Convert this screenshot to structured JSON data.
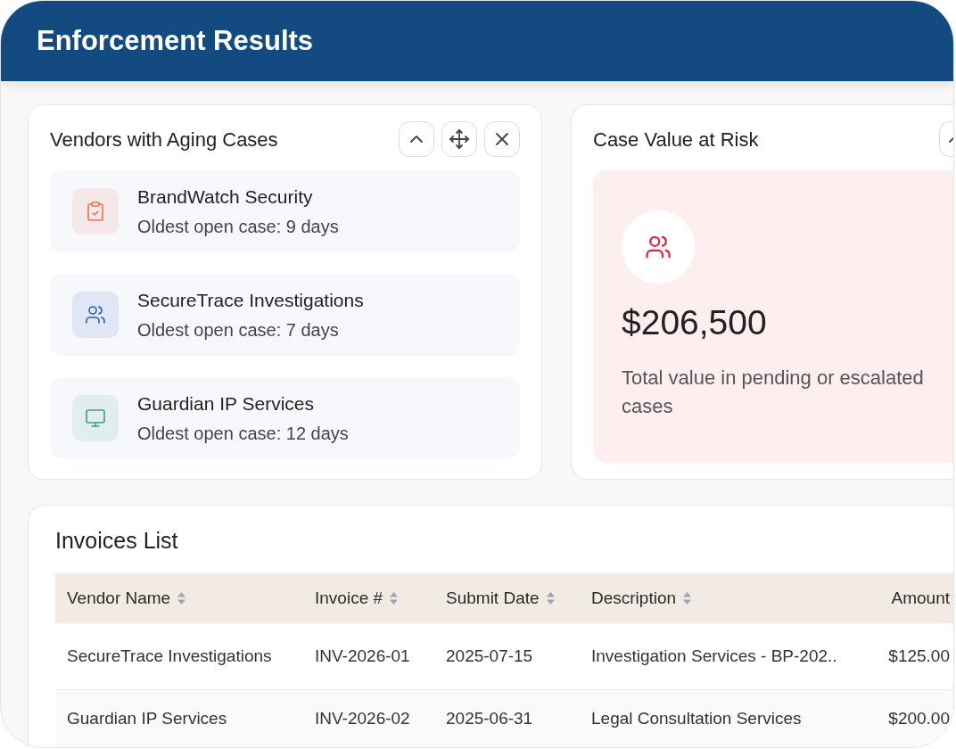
{
  "header": {
    "title": "Enforcement Results"
  },
  "aging_vendors": {
    "title": "Vendors with Aging Cases",
    "items": [
      {
        "name": "BrandWatch Security",
        "detail": "Oldest open case: 9 days",
        "color": "#f0704f"
      },
      {
        "name": "SecureTrace Investigations",
        "detail": "Oldest open case: 7 days",
        "color": "#2d5fb0"
      },
      {
        "name": "Guardian IP Services",
        "detail": "Oldest open case: 12 days",
        "color": "#3f9f7e"
      }
    ]
  },
  "value_at_risk": {
    "title": "Case Value at Risk",
    "value": "$206,500",
    "description": "Total value in pending or escalated cases"
  },
  "invoices": {
    "title": "Invoices List",
    "columns": [
      {
        "label": "Vendor Name",
        "sortable": true
      },
      {
        "label": "Invoice #",
        "sortable": true
      },
      {
        "label": "Submit Date",
        "sortable": true
      },
      {
        "label": "Description",
        "sortable": true
      },
      {
        "label": "Amount",
        "sortable": false
      }
    ],
    "rows": [
      [
        "SecureTrace Investigations",
        "INV-2026-01",
        "2025-07-15",
        "Investigation Services - BP-202..",
        "$125.00"
      ],
      [
        "Guardian IP Services",
        "INV-2026-02",
        "2025-06-31",
        "Legal Consultation Services",
        "$200.00"
      ]
    ]
  }
}
